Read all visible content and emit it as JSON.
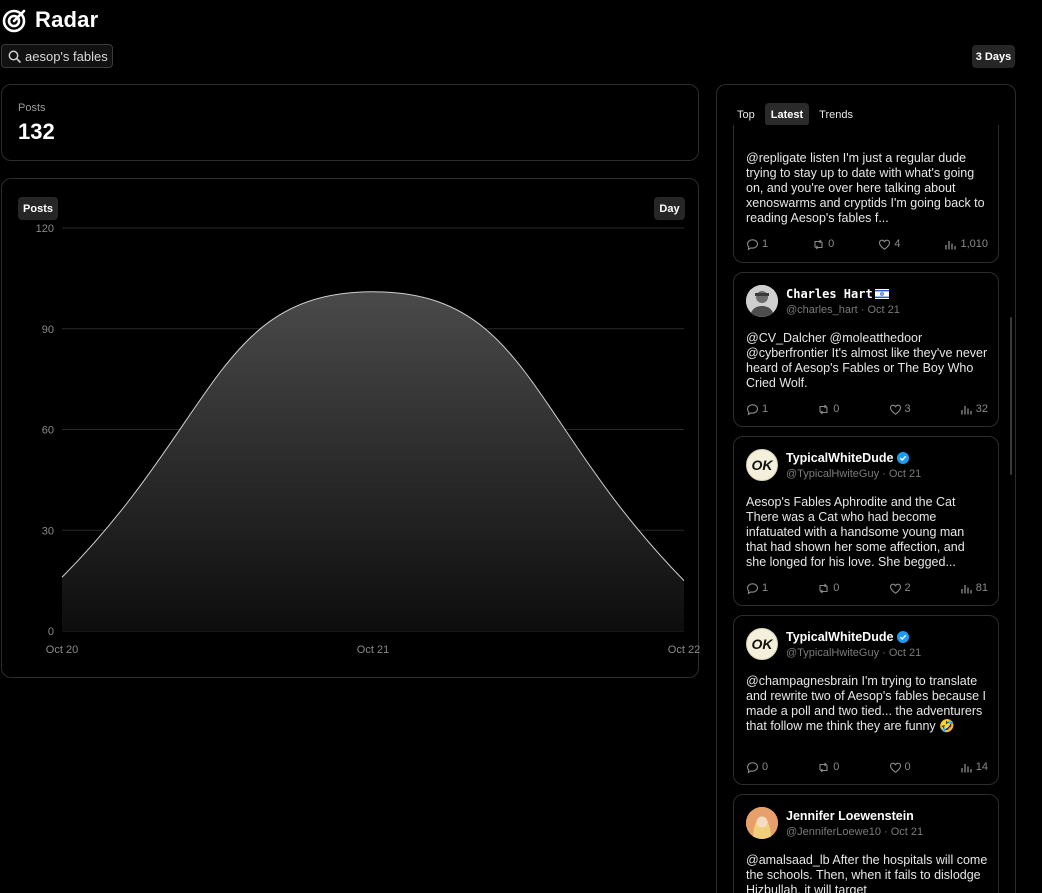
{
  "app": {
    "title": "Radar"
  },
  "search": {
    "value": "aesop's fables",
    "placeholder": ""
  },
  "range_button": "3 Days",
  "stats": {
    "label": "Posts",
    "value": "132"
  },
  "chart": {
    "metric_label": "Posts",
    "granularity_label": "Day"
  },
  "chart_data": {
    "type": "area",
    "x": [
      "Oct 20",
      "Oct 21",
      "Oct 22"
    ],
    "x_tick_labels": [
      "Oct 20",
      "Oct 21",
      "Oct 22"
    ],
    "values": [
      16,
      101,
      15
    ],
    "yticks": [
      0,
      30,
      60,
      90,
      120
    ],
    "ylim": [
      0,
      120
    ],
    "grid": true,
    "legend": "none",
    "colors": {
      "line": "#cfcfcf",
      "fill_top": "#4a4a4a",
      "fill_bottom": "#0d0d0d",
      "grid": "#2a2a2a"
    }
  },
  "feed": {
    "tabs": [
      {
        "label": "Top",
        "active": false
      },
      {
        "label": "Latest",
        "active": true
      },
      {
        "label": "Trends",
        "active": false
      }
    ],
    "posts": [
      {
        "text": "@repligate listen I'm just a regular dude trying to stay up to date with what's going on, and you're over here talking about xenoswarms and cryptids I'm going back to reading Aesop's fables f...",
        "replies": "1",
        "reposts": "0",
        "likes": "4",
        "views": "1,010"
      },
      {
        "name": "Charles Hart",
        "handle": "@charles_hart",
        "date": "Oct 21",
        "text": "@CV_Dalcher @moleatthedoor @cyberfrontier It's almost like they've never heard of Aesop's Fables or The Boy Who Cried Wolf.",
        "replies": "1",
        "reposts": "0",
        "likes": "3",
        "views": "32"
      },
      {
        "name": "TypicalWhiteDude",
        "handle": "@TypicalHwiteGuy",
        "date": "Oct 21",
        "avatar_text": "OK",
        "text": "Aesop's Fables Aphrodite and the Cat There was a Cat who had become infatuated with a handsome young man that had shown her some affection, and she longed for his love. She begged...",
        "replies": "1",
        "reposts": "0",
        "likes": "2",
        "views": "81"
      },
      {
        "name": "TypicalWhiteDude",
        "handle": "@TypicalHwiteGuy",
        "date": "Oct 21",
        "avatar_text": "OK",
        "text": "@champagnesbrain I'm trying to translate and rewrite two of Aesop's fables because I made a poll and two tied... the adventurers that follow me think they are funny 🤣",
        "replies": "0",
        "reposts": "0",
        "likes": "0",
        "views": "14"
      },
      {
        "name": "Jennifer Loewenstein",
        "handle": "@JenniferLoewe10",
        "date": "Oct 21",
        "text": "@amalsaad_lb After the hospitals will come the schools. Then, when it fails to dislodge Hizbullah, it will target"
      }
    ]
  }
}
